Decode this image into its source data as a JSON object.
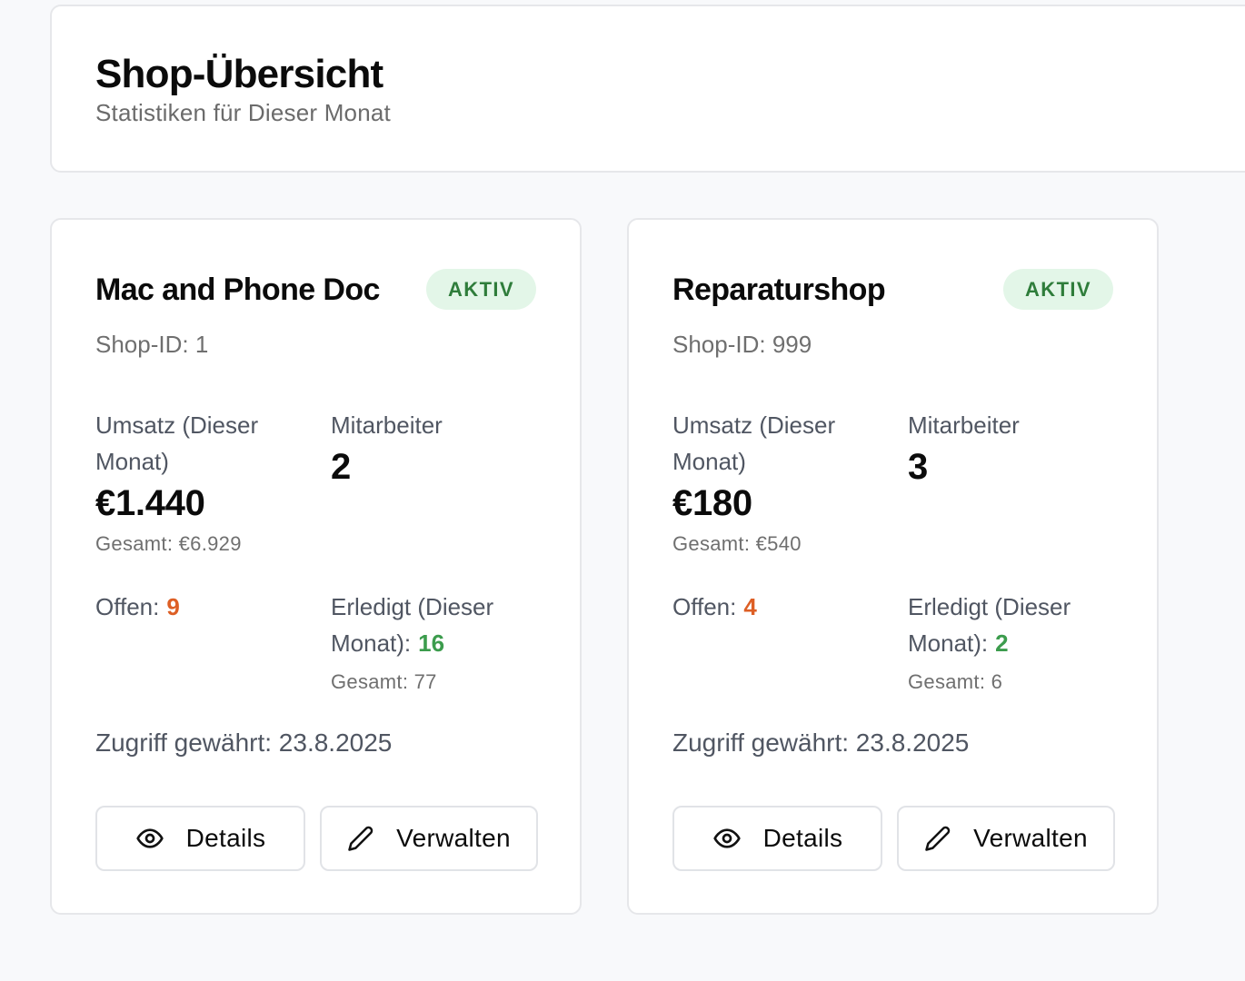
{
  "header": {
    "title": "Shop-Übersicht",
    "subtitle": "Statistiken für Dieser Monat"
  },
  "shops": [
    {
      "name": "Mac and Phone Doc",
      "status": "AKTIV",
      "shop_id": "Shop-ID: 1",
      "revenue_label": "Umsatz (Dieser Monat)",
      "revenue_value": "€1.440",
      "revenue_total": "Gesamt: €6.929",
      "employees_label": "Mitarbeiter",
      "employees_value": "2",
      "open_label": "Offen:",
      "open_value": "9",
      "done_label": "Erledigt (Dieser Monat):",
      "done_value": "16",
      "done_total": "Gesamt: 77",
      "access": "Zugriff gewährt: 23.8.2025",
      "details_label": "Details",
      "manage_label": "Verwalten"
    },
    {
      "name": "Reparaturshop",
      "status": "AKTIV",
      "shop_id": "Shop-ID: 999",
      "revenue_label": "Umsatz (Dieser Monat)",
      "revenue_value": "€180",
      "revenue_total": "Gesamt: €540",
      "employees_label": "Mitarbeiter",
      "employees_value": "3",
      "open_label": "Offen:",
      "open_value": "4",
      "done_label": "Erledigt (Dieser Monat):",
      "done_value": "2",
      "done_total": "Gesamt: 6",
      "access": "Zugriff gewährt: 23.8.2025",
      "details_label": "Details",
      "manage_label": "Verwalten"
    }
  ],
  "colors": {
    "badge_bg": "#e3f6e8",
    "badge_text": "#2f7d3b",
    "open_count": "#dd5f25",
    "done_count": "#3c9c4d"
  },
  "icons": {
    "details": "eye-icon",
    "manage": "pencil-icon"
  }
}
